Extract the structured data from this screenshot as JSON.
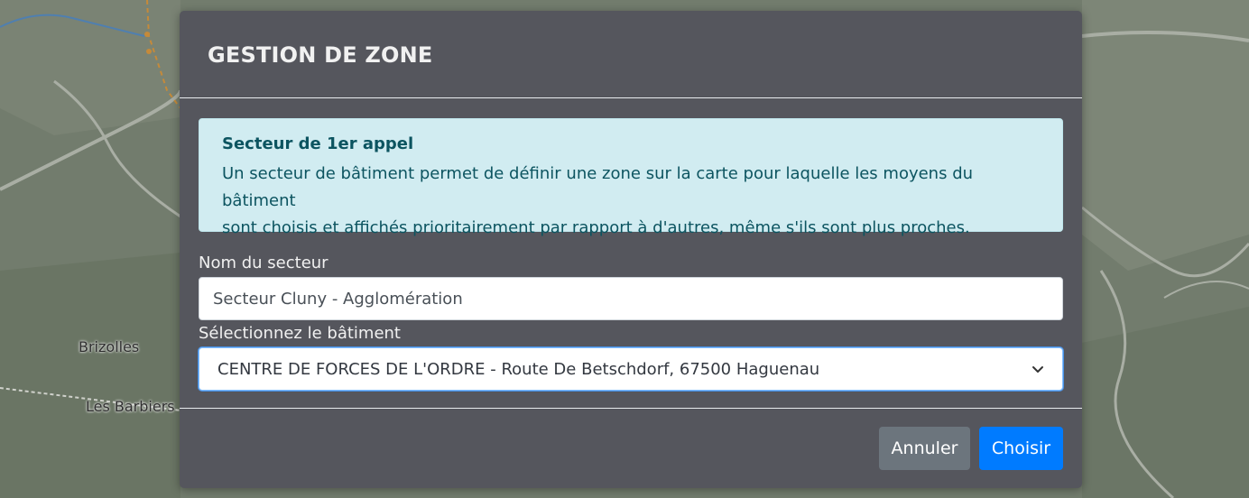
{
  "map": {
    "place_labels": [
      "Brizolles",
      "Les Barbiers"
    ]
  },
  "modal": {
    "title": "GESTION DE ZONE",
    "info": {
      "title": "Secteur de 1er appel",
      "text_line1": "Un secteur de bâtiment permet de définir une zone sur la carte pour laquelle les moyens du bâtiment",
      "text_line2": "sont choisis et affichés prioritairement par rapport à d'autres, même s'ils sont plus proches."
    },
    "sector_name": {
      "label": "Nom du secteur",
      "value": "Secteur Cluny - Agglomération"
    },
    "building": {
      "label": "Sélectionnez le bâtiment",
      "selected": "CENTRE DE FORCES DE L'ORDRE - Route De Betschdorf, 67500 Haguenau"
    },
    "buttons": {
      "cancel": "Annuler",
      "choose": "Choisir"
    }
  },
  "colors": {
    "modal_bg": "#55565d",
    "info_bg": "#d1ecf1",
    "info_text": "#0c5460",
    "cancel_bg": "#6c757d",
    "primary": "#007bff"
  },
  "icons": {
    "select_arrow": "chevron-down-icon"
  }
}
